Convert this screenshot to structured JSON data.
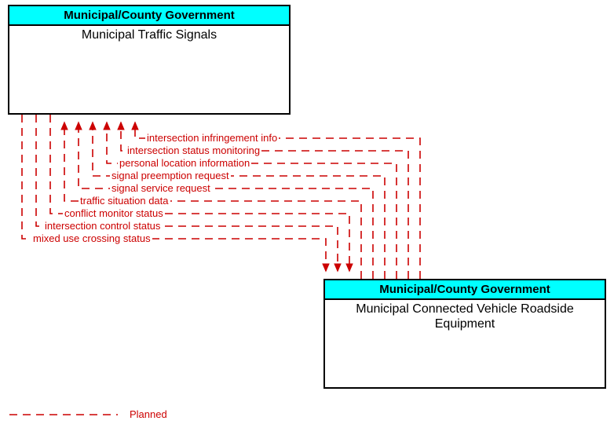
{
  "box1": {
    "header": "Municipal/County Government",
    "title": "Municipal Traffic Signals"
  },
  "box2": {
    "header": "Municipal/County Government",
    "title": "Municipal Connected Vehicle Roadside Equipment"
  },
  "flows": {
    "f1": "intersection infringement info",
    "f2": "intersection status monitoring",
    "f3": "personal location information",
    "f4": "signal preemption request",
    "f5": "signal service request",
    "f6": "traffic situation data",
    "f7": "conflict monitor status",
    "f8": "intersection control status",
    "f9": "mixed use crossing status"
  },
  "legend": "Planned"
}
